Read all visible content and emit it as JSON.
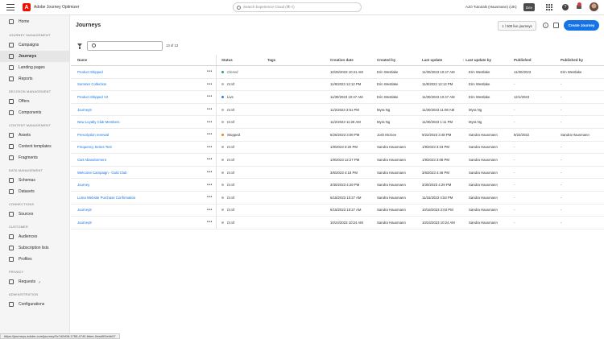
{
  "app": {
    "name": "Adobe Journey Optimizer",
    "logo_letter": "A"
  },
  "topbar": {
    "search_placeholder": "Search Experience Cloud (⌘+/)",
    "org": "AJO Tutorials (Hausmann) (UK)",
    "env_badge": "Dev",
    "help_label": "?"
  },
  "sidebar": {
    "home": "Home",
    "sections": [
      {
        "title": "JOURNEY MANAGEMENT",
        "items": [
          "Campaigns",
          "Journeys",
          "Landing pages",
          "Reports"
        ]
      },
      {
        "title": "DECISION MANAGEMENT",
        "items": [
          "Offers",
          "Components"
        ]
      },
      {
        "title": "CONTENT MANAGEMENT",
        "items": [
          "Assets",
          "Content templates",
          "Fragments"
        ]
      },
      {
        "title": "DATA MANAGEMENT",
        "items": [
          "Schemas",
          "Datasets"
        ]
      },
      {
        "title": "CONNECTIONS",
        "items": [
          "Sources"
        ]
      },
      {
        "title": "CUSTOMER",
        "items": [
          "Audiences",
          "Subscription lists",
          "Profiles"
        ]
      },
      {
        "title": "PRIVACY",
        "items": [
          "Requests"
        ]
      },
      {
        "title": "ADMINISTRATION",
        "items": [
          "Configurations"
        ]
      }
    ],
    "active_item": "Journeys"
  },
  "main": {
    "title": "Journeys",
    "live_badge": "1 / 500 live journeys",
    "create_button": "Create Journey",
    "count_text": "13 of 13",
    "columns": {
      "name": "Name",
      "status": "Status",
      "tags": "Tags",
      "creation_date": "Creation date",
      "created_by": "Created by",
      "last_update": "Last update",
      "last_update_by": "Last update by",
      "published": "Published",
      "published_by": "Published by"
    },
    "sort_arrow": "↑",
    "more_glyph": "•••",
    "rows": [
      {
        "name": "Product Shipped",
        "status": "Closed",
        "status_color": "#2d9d78",
        "italic": true,
        "creation_date": "10/25/2023 10:41 AM",
        "created_by": "Erin Westlake",
        "last_update": "11/30/2023 10:47 AM",
        "last_update_by": "Erin Westlake",
        "published": "11/30/2023",
        "published_by": "Erin Westlake"
      },
      {
        "name": "Summer Collection",
        "status": "Draft",
        "status_color": "#b3b3b3",
        "italic": true,
        "creation_date": "11/8/2023 12:12 PM",
        "created_by": "Erin Westlake",
        "last_update": "11/8/2023 12:12 PM",
        "last_update_by": "Erin Westlake",
        "published": "-",
        "published_by": "-"
      },
      {
        "name": "Product Shipped V2",
        "status": "Live",
        "status_color": "#2680eb",
        "italic": false,
        "creation_date": "11/30/2023 10:47 AM",
        "created_by": "Erin Westlake",
        "last_update": "11/30/2023 10:47 AM",
        "last_update_by": "Erin Westlake",
        "published": "12/1/2023",
        "published_by": "-"
      },
      {
        "name": "Journey9",
        "status": "Draft",
        "status_color": "#b3b3b3",
        "italic": true,
        "creation_date": "11/2/2023 3:51 PM",
        "created_by": "Myra Ng",
        "last_update": "11/30/2023 11:08 AM",
        "last_update_by": "Myra Ng",
        "published": "-",
        "published_by": "-"
      },
      {
        "name": "New Loyalty Club Members",
        "status": "Draft",
        "status_color": "#b3b3b3",
        "italic": true,
        "creation_date": "11/2/2023 11:28 AM",
        "created_by": "Myra Ng",
        "last_update": "11/30/2023 1:11 PM",
        "last_update_by": "Myra Ng",
        "published": "-",
        "published_by": "-"
      },
      {
        "name": "Prescription renewal",
        "status": "Stopped",
        "status_color": "#e68619",
        "italic": false,
        "creation_date": "5/26/2023 3:09 PM",
        "created_by": "Josh McGee",
        "last_update": "9/22/2023 3:48 PM",
        "last_update_by": "Sandra Hausmann",
        "published": "9/22/2022",
        "published_by": "Sandra Hausmann"
      },
      {
        "name": "Frequency Series Test",
        "status": "Draft",
        "status_color": "#b3b3b3",
        "italic": true,
        "creation_date": "1/9/2023 3:20 PM",
        "created_by": "Sandra Hausmann",
        "last_update": "1/9/2023 3:23 PM",
        "last_update_by": "Sandra Hausmann",
        "published": "-",
        "published_by": "-"
      },
      {
        "name": "Cart Abandonment",
        "status": "Draft",
        "status_color": "#b3b3b3",
        "italic": true,
        "creation_date": "1/9/2023 12:27 PM",
        "created_by": "Sandra Hausmann",
        "last_update": "1/9/2023 3:08 PM",
        "last_update_by": "Sandra Hausmann",
        "published": "-",
        "published_by": "-"
      },
      {
        "name": "Welcome Campaign - Gold Club",
        "status": "Draft",
        "status_color": "#b3b3b3",
        "italic": true,
        "creation_date": "3/6/2023 4:18 PM",
        "created_by": "Sandra Hausmann",
        "last_update": "3/6/2023 4:46 PM",
        "last_update_by": "Sandra Hausmann",
        "published": "-",
        "published_by": "-"
      },
      {
        "name": "Journey",
        "status": "Draft",
        "status_color": "#b3b3b3",
        "italic": true,
        "creation_date": "3/30/2023 4:29 PM",
        "created_by": "Sandra Hausmann",
        "last_update": "3/30/2023 4:29 PM",
        "last_update_by": "Sandra Hausmann",
        "published": "-",
        "published_by": "-"
      },
      {
        "name": "Luma Website Purchase Confirmation",
        "status": "Draft",
        "status_color": "#b3b3b3",
        "italic": true,
        "creation_date": "6/15/2023 10:27 AM",
        "created_by": "Sandra Hausmann",
        "last_update": "11/15/2023 4:53 PM",
        "last_update_by": "Sandra Hausmann",
        "published": "-",
        "published_by": "-"
      },
      {
        "name": "Journey8",
        "status": "Draft",
        "status_color": "#b3b3b3",
        "italic": true,
        "creation_date": "6/15/2023 10:27 AM",
        "created_by": "Sandra Hausmann",
        "last_update": "10/16/2023 2:03 PM",
        "last_update_by": "Sandra Hausmann",
        "published": "-",
        "published_by": "-"
      },
      {
        "name": "Journey9",
        "status": "Draft",
        "status_color": "#b3b3b3",
        "italic": true,
        "creation_date": "10/24/2023 10:24 AM",
        "created_by": "Sandra Hausmann",
        "last_update": "10/24/2023 10:24 AM",
        "last_update_by": "Sandra Hausmann",
        "published": "-",
        "published_by": "-"
      }
    ]
  },
  "statusbar": {
    "url": "https://journeys.adobe.com/journey/5c7d2d08-1755-4740-bbee-0ead0f1ebb07"
  }
}
